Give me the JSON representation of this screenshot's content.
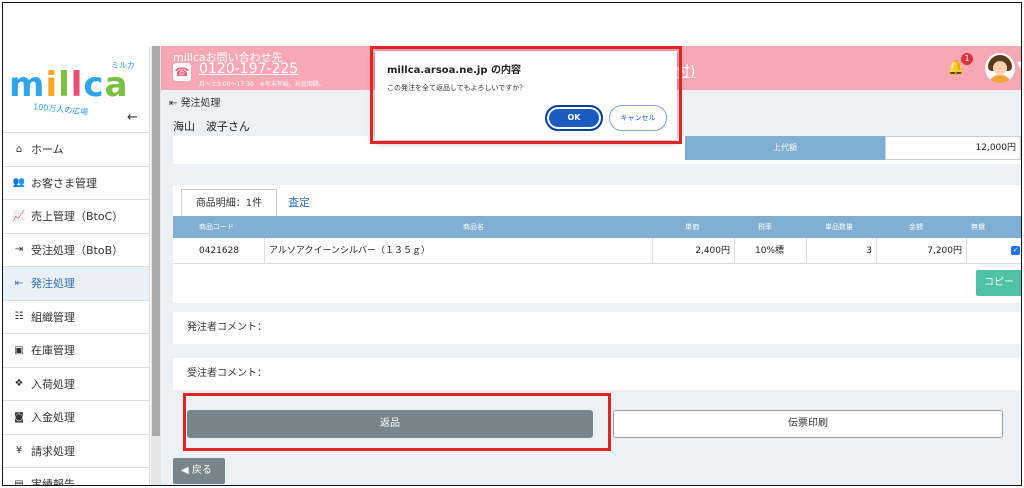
{
  "logo": {
    "text": "millca",
    "ruby": "ミルカ",
    "tagline": "100万人の広場"
  },
  "sidebar": {
    "items": [
      {
        "label": "ホーム",
        "icon": "home-icon",
        "glyph": "⌂"
      },
      {
        "label": "お客さま管理",
        "icon": "users-icon",
        "glyph": "👥"
      },
      {
        "label": "売上管理（BtoC）",
        "icon": "line-chart-icon",
        "glyph": "📈"
      },
      {
        "label": "受注処理（BtoB）",
        "icon": "sign-in-icon",
        "glyph": "⇥"
      },
      {
        "label": "発注処理",
        "icon": "sign-out-icon",
        "glyph": "⇤"
      },
      {
        "label": "組織管理",
        "icon": "sitemap-icon",
        "glyph": "☷"
      },
      {
        "label": "在庫管理",
        "icon": "archive-icon",
        "glyph": "▣"
      },
      {
        "label": "入荷処理",
        "icon": "cubes-icon",
        "glyph": "❖"
      },
      {
        "label": "入金処理",
        "icon": "money-icon",
        "glyph": "◙"
      },
      {
        "label": "請求処理",
        "icon": "yen-icon",
        "glyph": "¥"
      },
      {
        "label": "実績報告",
        "icon": "report-icon",
        "glyph": "▤"
      }
    ],
    "collapse_glyph": "←"
  },
  "header": {
    "title": "millcaお問い合わせ先",
    "phone": "0120-197-225",
    "hours": "月～土9:00～17:30　※年末年始、お盆期間、",
    "link": "付)",
    "notif_count": "1"
  },
  "main": {
    "breadcrumb": "発注処理",
    "customer": "海山　波子さん",
    "upper_label": "上代額",
    "upper_value": "12,000円",
    "tabs": [
      {
        "label": "商品明細：1件"
      },
      {
        "label": "査定"
      }
    ],
    "table": {
      "headers": [
        "商品コード",
        "商品名",
        "単価",
        "税率",
        "単品数量",
        "金額",
        "無償"
      ],
      "rows": [
        {
          "code": "0421628",
          "name": "アルソアクイーンシルバー（１３５ｇ）",
          "price": "2,400円",
          "tax": "10%標",
          "qty": "3",
          "amount": "7,200円",
          "free": "✓"
        }
      ]
    },
    "copy_label": "コピー",
    "orderer_comment": "発注者コメント：",
    "receiver_comment": "受注者コメント：",
    "return_label": "返品",
    "print_label": "伝票印刷",
    "back_label": "戻る"
  },
  "dialog": {
    "title": "millca.arsoa.ne.jp の内容",
    "message": "この発注を全て返品してもよろしいですか？",
    "ok_label": "OK",
    "cancel_label": "キャンセル"
  },
  "colors": {
    "header": "#f7a8b4",
    "table_header": "#7fb0d3",
    "highlight": "#e02424",
    "ok_button": "#1a5bbf"
  }
}
